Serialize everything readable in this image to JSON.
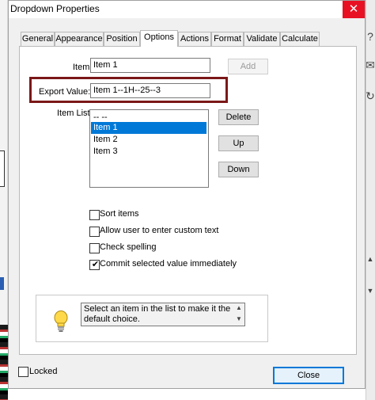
{
  "window": {
    "title": "Dropdown Properties",
    "close_glyph": "✕"
  },
  "tabs": [
    {
      "label": "General"
    },
    {
      "label": "Appearance"
    },
    {
      "label": "Position"
    },
    {
      "label": "Options",
      "active": true
    },
    {
      "label": "Actions"
    },
    {
      "label": "Format"
    },
    {
      "label": "Validate"
    },
    {
      "label": "Calculate"
    }
  ],
  "options": {
    "item_label": "Item:",
    "item_value": "Item 1",
    "add_label": "Add",
    "export_label": "Export Value:",
    "export_value": "Item 1--1H--25--3",
    "list_label": "Item List:",
    "list_items": [
      "-- --",
      "Item 1",
      "Item 2",
      "Item 3"
    ],
    "selected_item": "Item 1",
    "delete_label": "Delete",
    "up_label": "Up",
    "down_label": "Down",
    "checkboxes": [
      {
        "label": "Sort items",
        "checked": false
      },
      {
        "label": "Allow user to enter custom text",
        "checked": false
      },
      {
        "label": "Check spelling",
        "checked": false
      },
      {
        "label": "Commit selected value immediately",
        "checked": true
      }
    ],
    "tip_text": "Select an item in the list to make it the default choice."
  },
  "footer": {
    "locked_label": "Locked",
    "locked_checked": false,
    "close_label": "Close"
  },
  "colors": {
    "highlight_border": "#7b1818",
    "selection": "#0078d7",
    "close_button": "#e81123"
  }
}
